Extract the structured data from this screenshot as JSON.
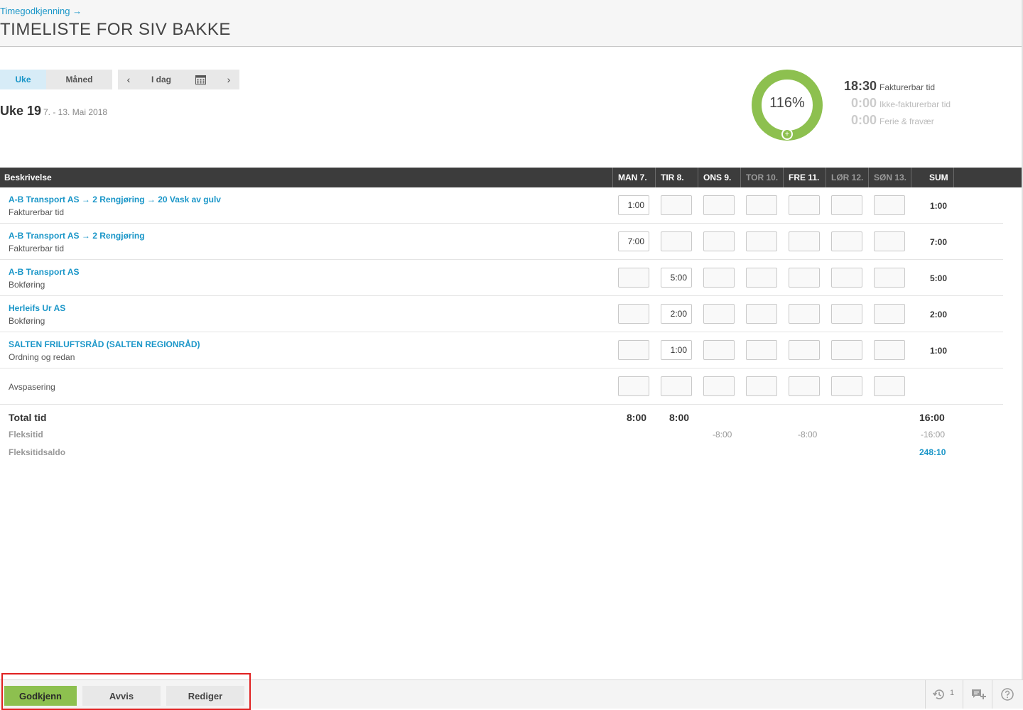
{
  "breadcrumb": "Timegodkjenning →",
  "page_title": "TIMELISTE FOR SIV BAKKE",
  "view_toggle": {
    "week": "Uke",
    "month": "Måned"
  },
  "date_nav": {
    "prev": "‹",
    "today": "I dag",
    "next": "›"
  },
  "week": {
    "title": "Uke 19",
    "range": "7. - 13. Mai 2018"
  },
  "summary": {
    "percent_label": "116%",
    "percent_value": 116,
    "plus": "+",
    "billable": {
      "value": "18:30",
      "label": "Fakturerbar tid"
    },
    "nonbillable": {
      "value": "0:00",
      "label": "Ikke-fakturerbar tid"
    },
    "leave": {
      "value": "0:00",
      "label": "Ferie & fravær"
    }
  },
  "table": {
    "headers": {
      "description": "Beskrivelse",
      "days": [
        "MAN 7.",
        "TIR 8.",
        "ONS 9.",
        "TOR 10.",
        "FRE 11.",
        "LØR 12.",
        "SØN 13."
      ],
      "sum": "SUM"
    },
    "rows": [
      {
        "title": "A-B Transport AS → 2 Rengjøring → 20 Vask av gulv",
        "subtitle": "Fakturerbar tid",
        "cells": [
          "1:00",
          "",
          "",
          "",
          "",
          "",
          ""
        ],
        "sum": "1:00"
      },
      {
        "title": "A-B Transport AS → 2 Rengjøring",
        "subtitle": "Fakturerbar tid",
        "cells": [
          "7:00",
          "",
          "",
          "",
          "",
          "",
          ""
        ],
        "sum": "7:00"
      },
      {
        "title": "A-B Transport AS",
        "subtitle": "Bokføring",
        "cells": [
          "",
          "5:00",
          "",
          "",
          "",
          "",
          ""
        ],
        "sum": "5:00"
      },
      {
        "title": "Herleifs Ur AS",
        "subtitle": "Bokføring",
        "cells": [
          "",
          "2:00",
          "",
          "",
          "",
          "",
          ""
        ],
        "sum": "2:00"
      },
      {
        "title": "SALTEN FRILUFTSRÅD (SALTEN REGIONRÅD)",
        "subtitle": "Ordning og redan",
        "cells": [
          "",
          "1:00",
          "",
          "",
          "",
          "",
          ""
        ],
        "sum": "1:00"
      },
      {
        "title": "",
        "subtitle": "Avspasering",
        "cells": [
          "",
          "",
          "",
          "",
          "",
          "",
          ""
        ],
        "sum": ""
      }
    ],
    "totals": {
      "total_label": "Total tid",
      "mon": "8:00",
      "tue": "8:00",
      "sum": "16:00",
      "flex_label": "Fleksitid",
      "flex_wed": "-8:00",
      "flex_fri": "-8:00",
      "flex_sum": "-16:00",
      "balance_label": "Fleksitidsaldo",
      "balance": "248:10"
    }
  },
  "footer": {
    "approve": "Godkjenn",
    "reject": "Avvis",
    "edit": "Rediger",
    "history_count": "1"
  },
  "colors": {
    "accent": "#1a96c8",
    "green": "#8dc04f",
    "header_bg": "#3c3c3c",
    "highlight": "#e02020"
  }
}
